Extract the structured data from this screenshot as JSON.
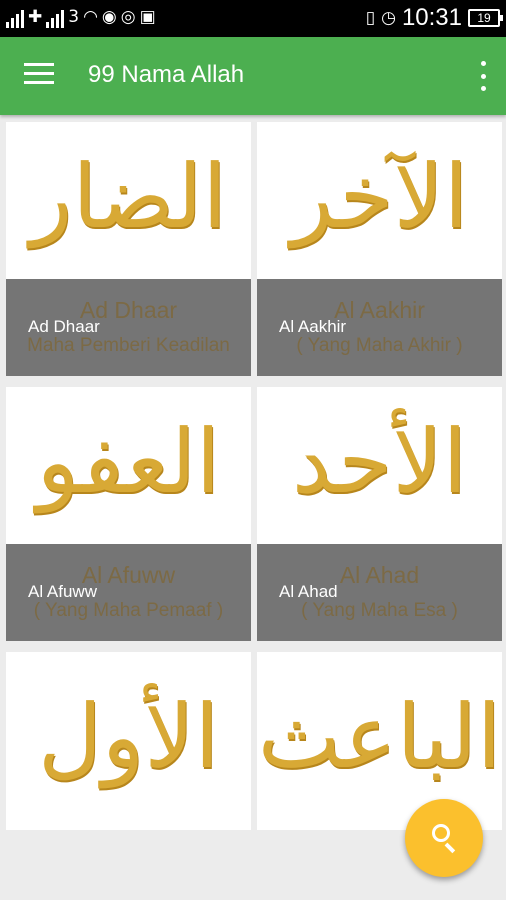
{
  "status_bar": {
    "time": "10:31",
    "battery": "19",
    "icons": [
      "signal-icon",
      "data-icon",
      "signal-icon",
      "network-3g-icon",
      "wifi-icon",
      "messenger-icon",
      "whatsapp-icon",
      "gallery-icon",
      "vibrate-icon",
      "alarm-icon",
      "battery-icon"
    ]
  },
  "app_bar": {
    "title": "99 Nama Allah",
    "color": "#4caf50"
  },
  "cards": [
    {
      "arabic": "الضار",
      "name": "Ad Dhaar",
      "meaning": "Maha Pemberi Keadilan"
    },
    {
      "arabic": "الآخر",
      "name": "Al Aakhir",
      "meaning": "( Yang Maha Akhir )"
    },
    {
      "arabic": "العفو",
      "name": "Al Afuww",
      "meaning": "( Yang Maha Pemaaf )"
    },
    {
      "arabic": "الأحد",
      "name": "Al Ahad",
      "meaning": "( Yang Maha Esa )"
    },
    {
      "arabic": "الأول",
      "name": "",
      "meaning": ""
    },
    {
      "arabic": "الباعث",
      "name": "",
      "meaning": ""
    }
  ],
  "fab": {
    "icon": "search-icon",
    "color": "#fbc02d"
  }
}
